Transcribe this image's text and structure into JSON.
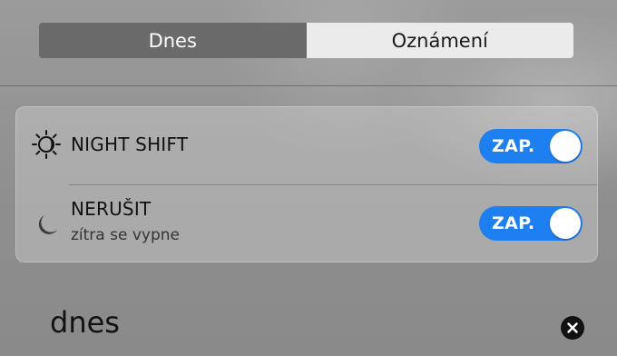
{
  "tabs": [
    {
      "label": "Dnes",
      "active": true
    },
    {
      "label": "Oznámení",
      "active": false
    }
  ],
  "controls": [
    {
      "title": "NIGHT SHIFT",
      "icon": "night-shift-sun-icon",
      "toggle_label": "ZAP.",
      "on": true
    },
    {
      "title": "NERUŠIT",
      "subtitle": "zítra se vypne",
      "icon": "moon-icon",
      "toggle_label": "ZAP.",
      "on": true
    }
  ],
  "section": {
    "title": "dnes",
    "close_icon": "close-icon"
  },
  "colors": {
    "toggle_on": "#1e7ff0",
    "segment_active": "#6a6a6a",
    "segment_inactive": "#ebebeb"
  }
}
